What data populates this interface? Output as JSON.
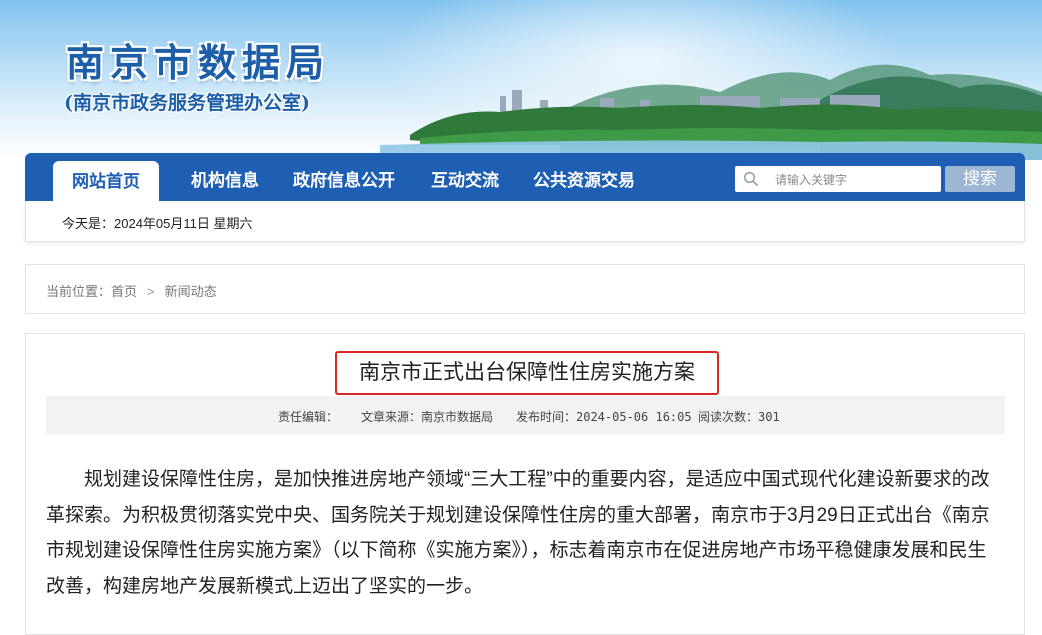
{
  "header": {
    "title": "南京市数据局",
    "subtitle": "(南京市政务服务管理办公室)"
  },
  "nav": {
    "items": [
      {
        "label": "网站首页",
        "active": true
      },
      {
        "label": "机构信息"
      },
      {
        "label": "政府信息公开"
      },
      {
        "label": "互动交流"
      },
      {
        "label": "公共资源交易"
      }
    ],
    "search_placeholder": "请输入关键字",
    "search_button": "搜索",
    "colors": {
      "nav_bg": "#1f5fb3",
      "search_btn_bg": "#9db6d4"
    }
  },
  "date_line": "今天是：2024年05月11日 星期六",
  "breadcrumb": {
    "prefix": "当前位置：",
    "items": [
      "首页",
      "新闻动态"
    ]
  },
  "article": {
    "title": "南京市正式出台保障性住房实施方案",
    "meta": {
      "editor": "责任编辑：",
      "source": "文章来源：南京市数据局",
      "published": "发布时间：2024-05-06 16:05",
      "views": "阅读次数：301"
    },
    "paragraph": "规划建设保障性住房，是加快推进房地产领域“三大工程”中的重要内容，是适应中国式现代化建设新要求的改革探索。为积极贯彻落实党中央、国务院关于规划建设保障性住房的重大部署，南京市于3月29日正式出台《南京市规划建设保障性住房实施方案》（以下简称《实施方案》），标志着南京市在促进房地产市场平稳健康发展和民生改善，构建房地产发展新模式上迈出了坚实的一步。",
    "highlight_color": "#e02525"
  }
}
